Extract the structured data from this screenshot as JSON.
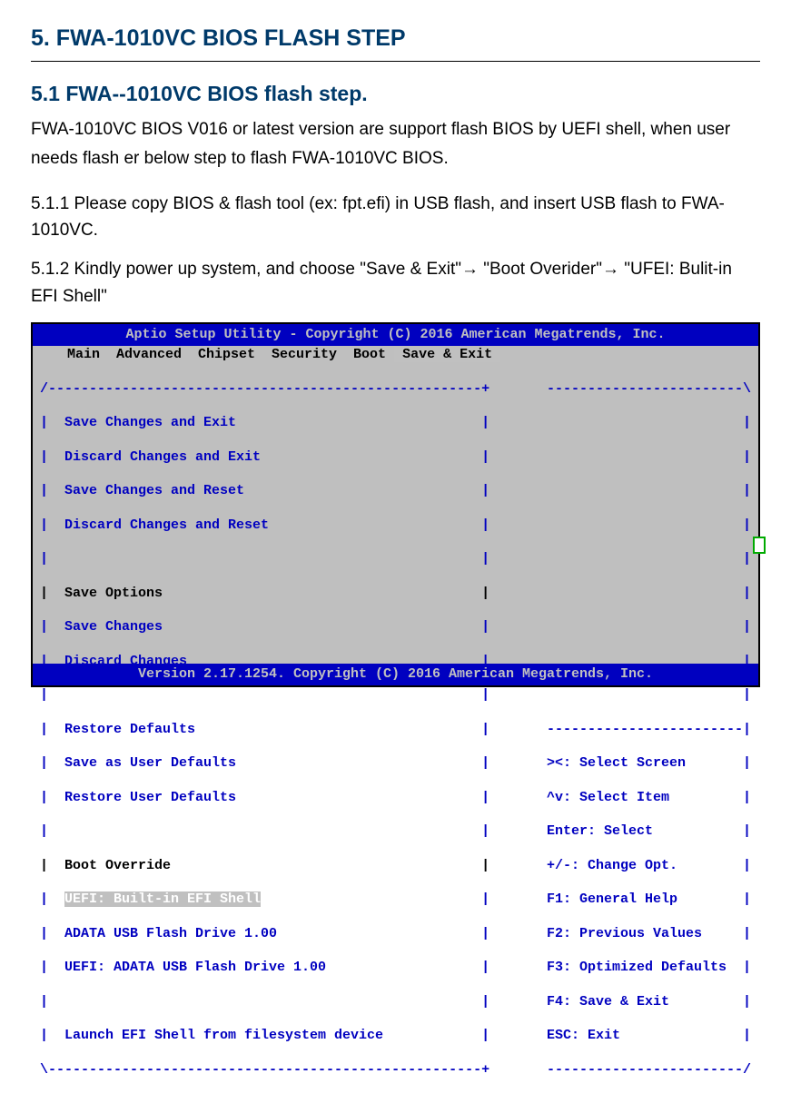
{
  "doc": {
    "h1": "5.  FWA-1010VC BIOS FLASH STEP",
    "h2": "5.1  FWA--1010VC BIOS flash step.",
    "intro": "FWA-1010VC BIOS V016 or latest version are support flash BIOS by UEFI shell, when user needs flash er below step to flash FWA-1010VC BIOS.",
    "step1": "5.1.1  Please copy BIOS & flash tool (ex: fpt.efi) in USB flash, and insert USB flash to FWA-1010VC.",
    "step2_prefix": "5.1.2  Kindly power up system, and choose \"Save & Exit\"",
    "step2_mid": " \"Boot Overider\"",
    "step2_end": " \"UFEI: Bulit-in EFI Shell\"",
    "arrow": "→"
  },
  "bios": {
    "title_bar": "Aptio Setup Utility - Copyright (C) 2016 American Megatrends, Inc.",
    "footer_bar": "Version 2.17.1254. Copyright (C) 2016 American Megatrends, Inc.",
    "menu_left": "  Main  Advanced  Chipset  Security  Boot ",
    "menu_active": " Save & Exit ",
    "left_top": "/-----------------------------------------------------+",
    "left_opt1": "|  Save Changes and Exit                              |",
    "left_opt2": "|  Discard Changes and Exit                           |",
    "left_opt3": "|  Save Changes and Reset                             |",
    "left_opt4": "|  Discard Changes and Reset                          |",
    "left_blank": "|                                                     |",
    "left_hdr1": "|  Save Options                                       |",
    "left_opt5": "|  Save Changes                                       |",
    "left_opt6": "|  Discard Changes                                    |",
    "left_opt7": "|  Restore Defaults                                   |",
    "left_opt8": "|  Save as User Defaults                              |",
    "left_opt9": "|  Restore User Defaults                              |",
    "left_hdr2": "|  Boot Override                                      |",
    "left_sel_pre": "|  ",
    "left_sel": "UEFI: Built-in EFI Shell",
    "left_sel_post": "                           |",
    "left_opt10": "|  ADATA USB Flash Drive 1.00                         |",
    "left_opt11": "|  UEFI: ADATA USB Flash Drive 1.00                   |",
    "left_opt12": "|  Launch EFI Shell from filesystem device            |",
    "left_bot": "\\-----------------------------------------------------+",
    "right_top": "------------------------\\",
    "right_blank": "                        |",
    "right_div": "------------------------|",
    "right_h1": "><: Select Screen       |",
    "right_h2": "^v: Select Item         |",
    "right_h3": "Enter: Select           |",
    "right_h4": "+/-: Change Opt.        |",
    "right_h5": "F1: General Help        |",
    "right_h6": "F2: Previous Values     |",
    "right_h7": "F3: Optimized Defaults  |",
    "right_h8": "F4: Save & Exit         |",
    "right_h9": "ESC: Exit               |",
    "right_bot": "------------------------/"
  }
}
